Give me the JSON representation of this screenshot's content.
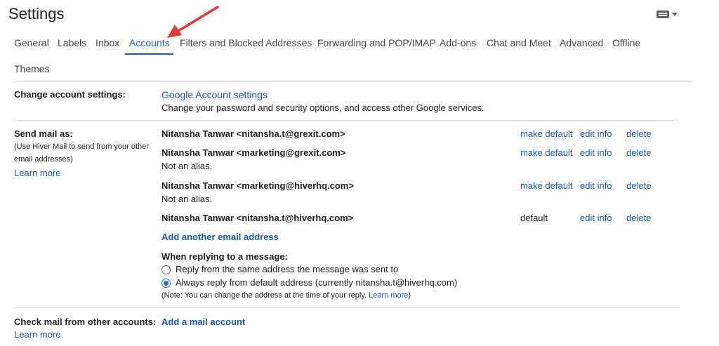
{
  "header": {
    "title": "Settings"
  },
  "tabs": [
    {
      "label": "General"
    },
    {
      "label": "Labels"
    },
    {
      "label": "Inbox"
    },
    {
      "label": "Accounts"
    },
    {
      "label": "Filters and Blocked Addresses"
    },
    {
      "label": "Forwarding and POP/IMAP"
    },
    {
      "label": "Add-ons"
    },
    {
      "label": "Chat and Meet"
    },
    {
      "label": "Advanced"
    },
    {
      "label": "Offline"
    },
    {
      "label": "Themes"
    }
  ],
  "active_tab": "Accounts",
  "colors": {
    "accent": "#1a5fb4",
    "link": "#1a57b5",
    "arrow": "#e53935",
    "radio": "#1a73e8"
  },
  "change_account": {
    "label": "Change account settings:",
    "link": "Google Account settings",
    "desc": "Change your password and security options, and access other Google services."
  },
  "send_mail": {
    "label": "Send mail as:",
    "sub1": "(Use Hiver Mail to send from your other",
    "sub2": "email addresses)",
    "learn_more": "Learn more",
    "accounts": [
      {
        "address": "Nitansha Tanwar <nitansha.t@grexit.com>",
        "note": "",
        "status": "make default",
        "edit": "edit info",
        "delete": "delete"
      },
      {
        "address": "Nitansha Tanwar <marketing@grexit.com>",
        "note": "Not an alias.",
        "status": "make default",
        "edit": "edit info",
        "delete": "delete"
      },
      {
        "address": "Nitansha Tanwar <marketing@hiverhq.com>",
        "note": "Not an alias.",
        "status": "make default",
        "edit": "edit info",
        "delete": "delete"
      },
      {
        "address": "Nitansha Tanwar <nitansha.t@hiverhq.com>",
        "note": "",
        "status": "default",
        "edit": "edit info",
        "delete": "delete"
      }
    ],
    "add_address": "Add another email address",
    "reply_heading": "When replying to a message:",
    "reply_options": [
      {
        "label": "Reply from the same address the message was sent to",
        "checked": false
      },
      {
        "label": "Always reply from default address (currently nitansha.t@hiverhq.com)",
        "checked": true
      }
    ],
    "note_text": "(Note: You can change the address at the time of your reply.",
    "note_link": "Learn more",
    "note_end": ")"
  },
  "check_mail": {
    "label": "Check mail from other accounts:",
    "link": "Add a mail account",
    "learn_more": "Learn more"
  },
  "icons": {
    "input_tools": "keyboard-icon",
    "dropdown": "caret-down-icon",
    "annotation": "red-arrow"
  }
}
